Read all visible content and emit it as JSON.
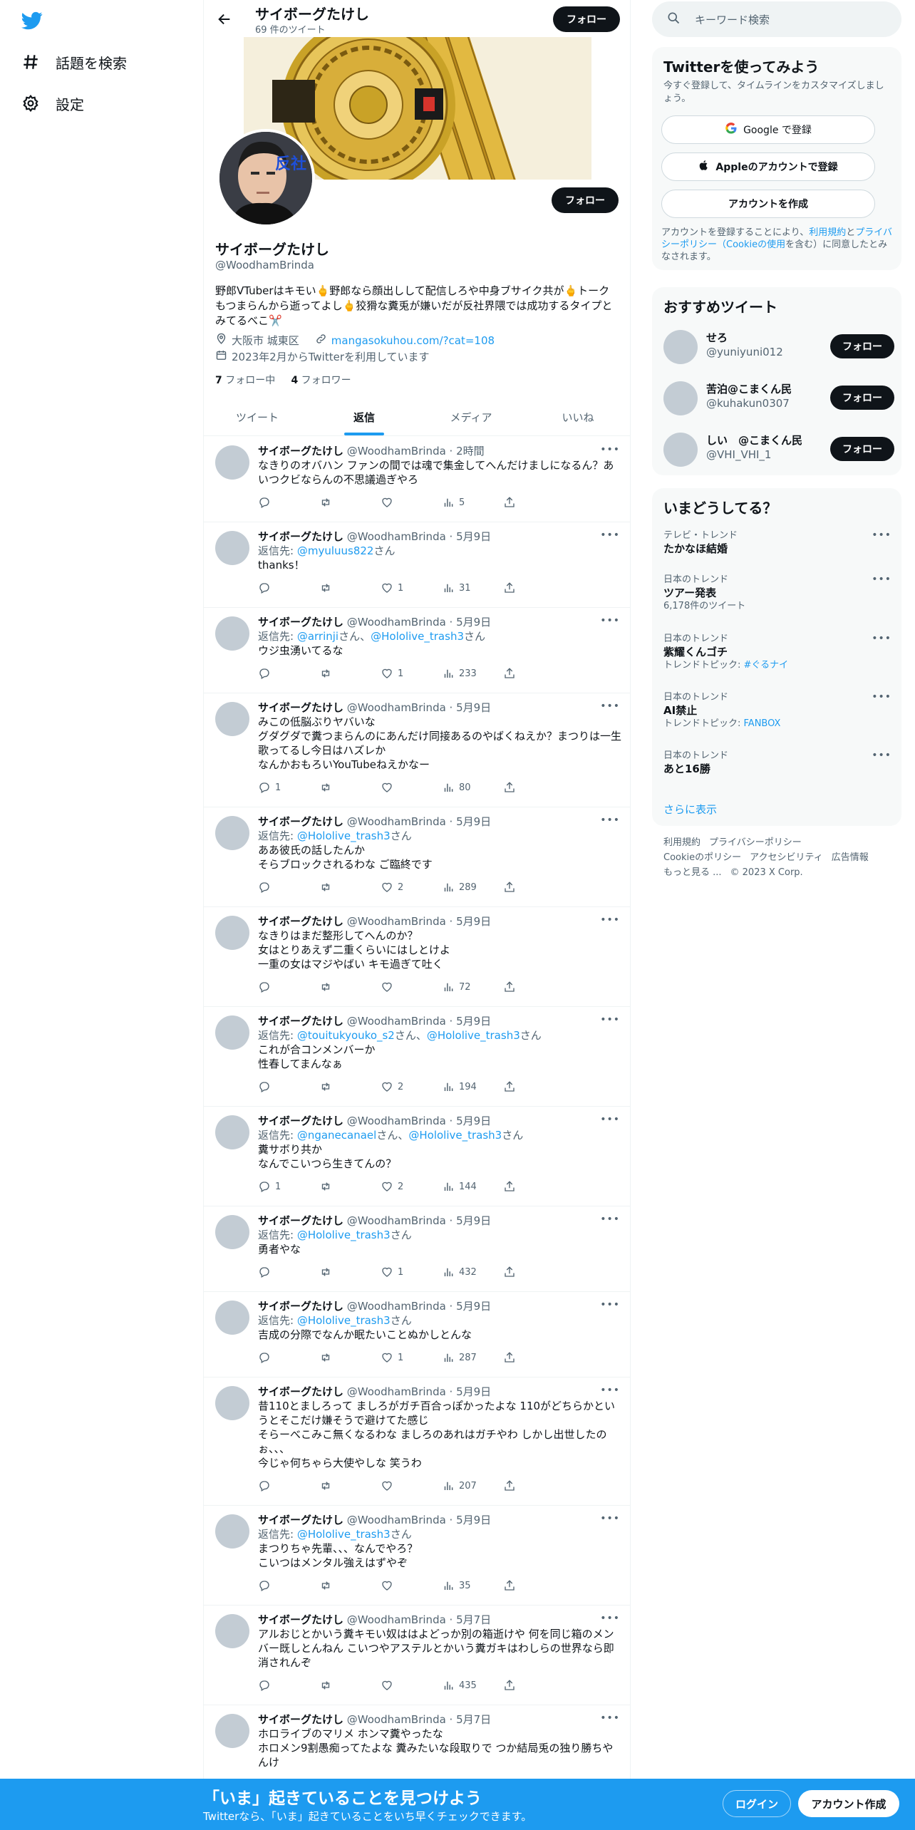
{
  "nav": {
    "explore_label": "話題を検索",
    "settings_label": "設定"
  },
  "header": {
    "name": "サイボーグたけし",
    "tweet_count": "69 件のツイート",
    "follow_label": "フォロー"
  },
  "profile": {
    "avatar_overlay_text": "反社",
    "name": "サイボーグたけし",
    "handle": "@WoodhamBrinda",
    "bio": "野郎VTuberはキモい🖕野郎なら顔出しして配信しろや中身ブサイク共が🖕トークもつまらんから逝ってよし🖕狡猾な糞兎が嫌いだが反社界隈では成功するタイプとみてるべこ✂️",
    "location": "大阪市 城東区",
    "url": "mangasokuhou.com/?cat=108",
    "joined": "2023年2月からTwitterを利用しています",
    "following_count": "7",
    "following_label": "フォロー中",
    "followers_count": "4",
    "followers_label": "フォロワー",
    "follow_label": "フォロー"
  },
  "tabs": [
    "ツイート",
    "返信",
    "メディア",
    "いいね"
  ],
  "tweets": [
    {
      "name": "サイボーグたけし",
      "meta": "@WoodhamBrinda · 2時間",
      "reply_to": [],
      "lines": [
        "なきりのオバハン ファンの間では魂で集金してへんだけましになるん？あいつクビならんの不思議過ぎやろ"
      ],
      "replies": "",
      "likes": "",
      "views": "5"
    },
    {
      "name": "サイボーグたけし",
      "meta": "@WoodhamBrinda · 5月9日",
      "reply_to": [
        "@myuluus822"
      ],
      "lines": [
        "thanks！"
      ],
      "replies": "",
      "likes": "1",
      "views": "31"
    },
    {
      "name": "サイボーグたけし",
      "meta": "@WoodhamBrinda · 5月9日",
      "reply_to": [
        "@arrinji",
        "@Hololive_trash3"
      ],
      "lines": [
        "ウジ虫湧いてるな"
      ],
      "replies": "",
      "likes": "1",
      "views": "233"
    },
    {
      "name": "サイボーグたけし",
      "meta": "@WoodhamBrinda · 5月9日",
      "reply_to": [],
      "lines": [
        "みこの低脳ぶりヤバいな",
        "グダグダで糞つまらんのにあんだけ同接あるのやばくねえか？まつりは一生歌ってるし今日はハズレか",
        "なんかおもろいYouTubeねえかなー"
      ],
      "replies": "1",
      "likes": "",
      "views": "80"
    },
    {
      "name": "サイボーグたけし",
      "meta": "@WoodhamBrinda · 5月9日",
      "reply_to": [
        "@Hololive_trash3"
      ],
      "lines": [
        "ああ彼氏の話したんか",
        "そらブロックされるわな ご臨終です"
      ],
      "replies": "",
      "likes": "2",
      "views": "289"
    },
    {
      "name": "サイボーグたけし",
      "meta": "@WoodhamBrinda · 5月9日",
      "reply_to": [],
      "lines": [
        "なきりはまだ整形してへんのか？",
        "女はとりあえず二重くらいにはしとけよ",
        "一重の女はマジやばい キモ過ぎて吐く"
      ],
      "replies": "",
      "likes": "",
      "views": "72"
    },
    {
      "name": "サイボーグたけし",
      "meta": "@WoodhamBrinda · 5月9日",
      "reply_to": [
        "@touitukyouko_s2",
        "@Hololive_trash3"
      ],
      "lines": [
        "これが合コンメンバーか",
        "性春してまんなぁ"
      ],
      "replies": "",
      "likes": "2",
      "views": "194"
    },
    {
      "name": "サイボーグたけし",
      "meta": "@WoodhamBrinda · 5月9日",
      "reply_to": [
        "@nganecanael",
        "@Hololive_trash3"
      ],
      "lines": [
        "糞サボり共か",
        "なんでこいつら生きてんの？"
      ],
      "replies": "1",
      "likes": "2",
      "views": "144"
    },
    {
      "name": "サイボーグたけし",
      "meta": "@WoodhamBrinda · 5月9日",
      "reply_to": [
        "@Hololive_trash3"
      ],
      "lines": [
        "勇者やな"
      ],
      "replies": "",
      "likes": "1",
      "views": "432"
    },
    {
      "name": "サイボーグたけし",
      "meta": "@WoodhamBrinda · 5月9日",
      "reply_to": [
        "@Hololive_trash3"
      ],
      "lines": [
        "吉成の分際でなんか眠たいことぬかしとんな"
      ],
      "replies": "",
      "likes": "1",
      "views": "287"
    },
    {
      "name": "サイボーグたけし",
      "meta": "@WoodhamBrinda · 5月9日",
      "reply_to": [],
      "lines": [
        "昔110とましろって ましろがガチ百合っぽかったよな 110がどちらかというとそこだけ嫌そうで避けてた感じ",
        "そらーべこみこ無くなるわな ましろのあれはガチやわ しかし出世したのぉ、、、",
        "今じゃ何ちゃら大使やしな 笑うわ"
      ],
      "replies": "",
      "likes": "",
      "views": "207"
    },
    {
      "name": "サイボーグたけし",
      "meta": "@WoodhamBrinda · 5月9日",
      "reply_to": [
        "@Hololive_trash3"
      ],
      "lines": [
        "まつりちゃ先輩、、、なんでやろ？",
        "こいつはメンタル強えはずやぞ"
      ],
      "replies": "",
      "likes": "",
      "views": "35"
    },
    {
      "name": "サイボーグたけし",
      "meta": "@WoodhamBrinda · 5月7日",
      "reply_to": [],
      "lines": [
        "アルおじとかいう糞キモい奴ははよどっか別の箱逝けや 何を同じ箱のメンバー既しとんねん こいつやアステルとかいう糞ガキはわしらの世界なら即消されんぞ"
      ],
      "replies": "",
      "likes": "",
      "views": "435"
    },
    {
      "name": "サイボーグたけし",
      "meta": "@WoodhamBrinda · 5月7日",
      "reply_to": [],
      "lines": [
        "ホロライブのマリメ ホンマ糞やったな",
        "ホロメン9割愚痴ってたよな 糞みたいな段取りで つか結局兎の独り勝ちやんけ"
      ],
      "replies": "",
      "likes": "",
      "views": ""
    }
  ],
  "reply_prefix": "返信先: ",
  "reply_suffix": "さん",
  "reply_joiner": "、",
  "search": {
    "placeholder": "キーワード検索"
  },
  "signup": {
    "title": "Twitterを使ってみよう",
    "subtitle": "今すぐ登録して、タイムラインをカスタマイズしましょう。",
    "google_label": "Google で登録",
    "apple_label": "Appleのアカウントで登録",
    "create_label": "アカウントを作成",
    "legal_pre": "アカウントを登録することにより、",
    "legal_terms": "利用規約",
    "legal_and": "と",
    "legal_privacy": "プライバシーポリシー（Cookieの使用",
    "legal_post": "を含む）に同意したとみなされます。"
  },
  "recommended": {
    "title": "おすすめツイート",
    "users": [
      {
        "name": "せろ",
        "handle": "@yuniyuni012",
        "follow_label": "フォロー"
      },
      {
        "name": "苦泊@こまくん民",
        "handle": "@kuhakun0307",
        "follow_label": "フォロー"
      },
      {
        "name": "しい　@こまくん民",
        "handle": "@VHI_VHI_1",
        "follow_label": "フォロー"
      }
    ]
  },
  "trends": {
    "title": "いまどうしてる？",
    "items": [
      {
        "category": "テレビ・トレンド",
        "name": "たかなほ結婚",
        "extra": ""
      },
      {
        "category": "日本のトレンド",
        "name": "ツアー発表",
        "extra": "6,178件のツイート"
      },
      {
        "category": "日本のトレンド",
        "name": "紫耀くんゴチ",
        "extra": "トレンドトピック: ",
        "extra_link": "#ぐるナイ"
      },
      {
        "category": "日本のトレンド",
        "name": "AI禁止",
        "extra": "トレンドトピック: ",
        "extra_link": "FANBOX"
      },
      {
        "category": "日本のトレンド",
        "name": "あと16勝",
        "extra": ""
      }
    ],
    "show_more": "さらに表示"
  },
  "footer": {
    "line1": [
      "利用規約",
      "プライバシーポリシー"
    ],
    "line2": [
      "Cookieのポリシー",
      "アクセシビリティ",
      "広告情報"
    ],
    "line3": [
      "もっと見る ...",
      "© 2023 X Corp."
    ]
  },
  "bottombar": {
    "title": "「いま」起きていることを見つけよう",
    "subtitle": "Twitterなら、「いま」起きていることをいち早くチェックできます。",
    "login_label": "ログイン",
    "signup_label": "アカウント作成"
  },
  "colors": {
    "accent": "#1d9bf0",
    "text": "#0f1419",
    "muted": "#536471",
    "gold": "#c9a227"
  }
}
